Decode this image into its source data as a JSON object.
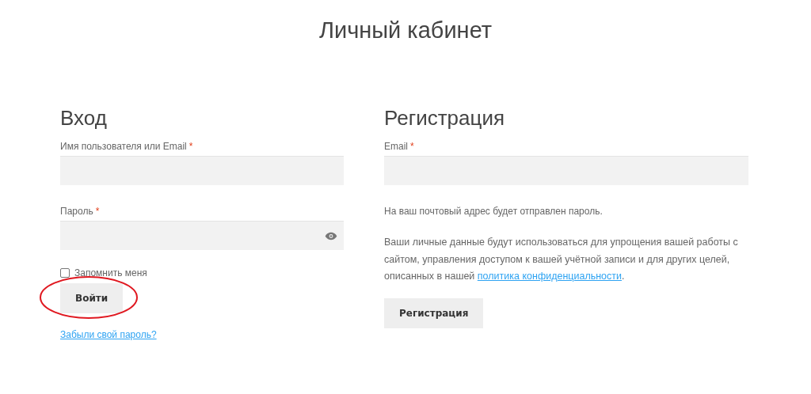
{
  "page_title": "Личный кабинет",
  "login": {
    "heading": "Вход",
    "fields": [
      {
        "kind": "text",
        "label": "Имя пользователя или Email",
        "required_mark": "*"
      },
      {
        "kind": "password",
        "label": "Пароль",
        "required_mark": "*"
      }
    ],
    "remember": {
      "label": "Запомнить меня",
      "checked": false
    },
    "button": "Войти",
    "button_mark": {
      "kind": "ellipse"
    },
    "forgot_link": "Забыли свой пароль?"
  },
  "register": {
    "heading": "Регистрация",
    "fields": [
      {
        "label": "Email",
        "required_mark": "*"
      }
    ],
    "note": "На ваш почтовый адрес будет отправлен пароль.",
    "privacy_text": "Ваши личные данные будут использоваться для упрощения вашей работы с сайтом, управления доступом к вашей учётной записи и для других целей, описанных в нашей",
    "privacy_link": "политика конфиденциальности",
    "privacy_end": ".",
    "button": "Регистрация"
  }
}
